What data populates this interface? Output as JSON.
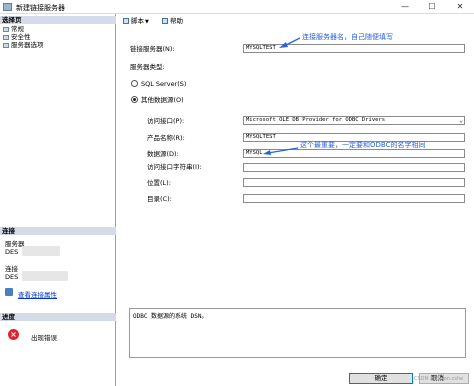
{
  "window": {
    "title": "新建链接服务器",
    "min": "—",
    "max": "☐",
    "close": "✕"
  },
  "sidebar": {
    "select_page_header": "选择页",
    "pages": [
      {
        "label": "常规",
        "icon": "page-icon"
      },
      {
        "label": "安全性",
        "icon": "page-icon"
      },
      {
        "label": "服务器选项",
        "icon": "page-icon"
      }
    ],
    "connection_header": "连接",
    "server_label": "服务器",
    "server_value": "DES",
    "connection_label": "连接",
    "connection_value": "DES",
    "view_conn_props": "查看连接属性",
    "progress_header": "进度",
    "progress_status": "出现错误"
  },
  "toolbar": {
    "script_label": "脚本",
    "help_label": "帮助"
  },
  "form": {
    "linked_server_label": "链接服务器(N):",
    "linked_server_value": "MYSQLTEST",
    "server_type_label": "服务器类型:",
    "sql_server_label": "SQL Server(S)",
    "other_source_label": "其他数据源(O)",
    "provider_label": "访问接口(P):",
    "provider_value": "Microsoft OLE DB Provider for ODBC Drivers",
    "product_name_label": "产品名称(R):",
    "product_name_value": "MYSQLTEST",
    "data_source_label": "数据源(D):",
    "data_source_value": "MYSQL",
    "provider_string_label": "访问接口字符串(I):",
    "provider_string_value": "",
    "location_label": "位置(L):",
    "location_value": "",
    "catalog_label": "目录(C):",
    "catalog_value": "",
    "description": "ODBC 数据源的系统 DSN。"
  },
  "annotations": {
    "server_name_note": "连接服务器名，自己随便填写",
    "data_source_note": "这个最重要，一定要和ODBC的名字相同"
  },
  "buttons": {
    "ok": "确定",
    "cancel": "取消"
  },
  "watermark": "CSDN @Eason.cshe",
  "colors": {
    "annotation": "#2a63d8",
    "section_header": "#d6dbe9",
    "error": "#d9262e",
    "link": "#0033cc"
  }
}
